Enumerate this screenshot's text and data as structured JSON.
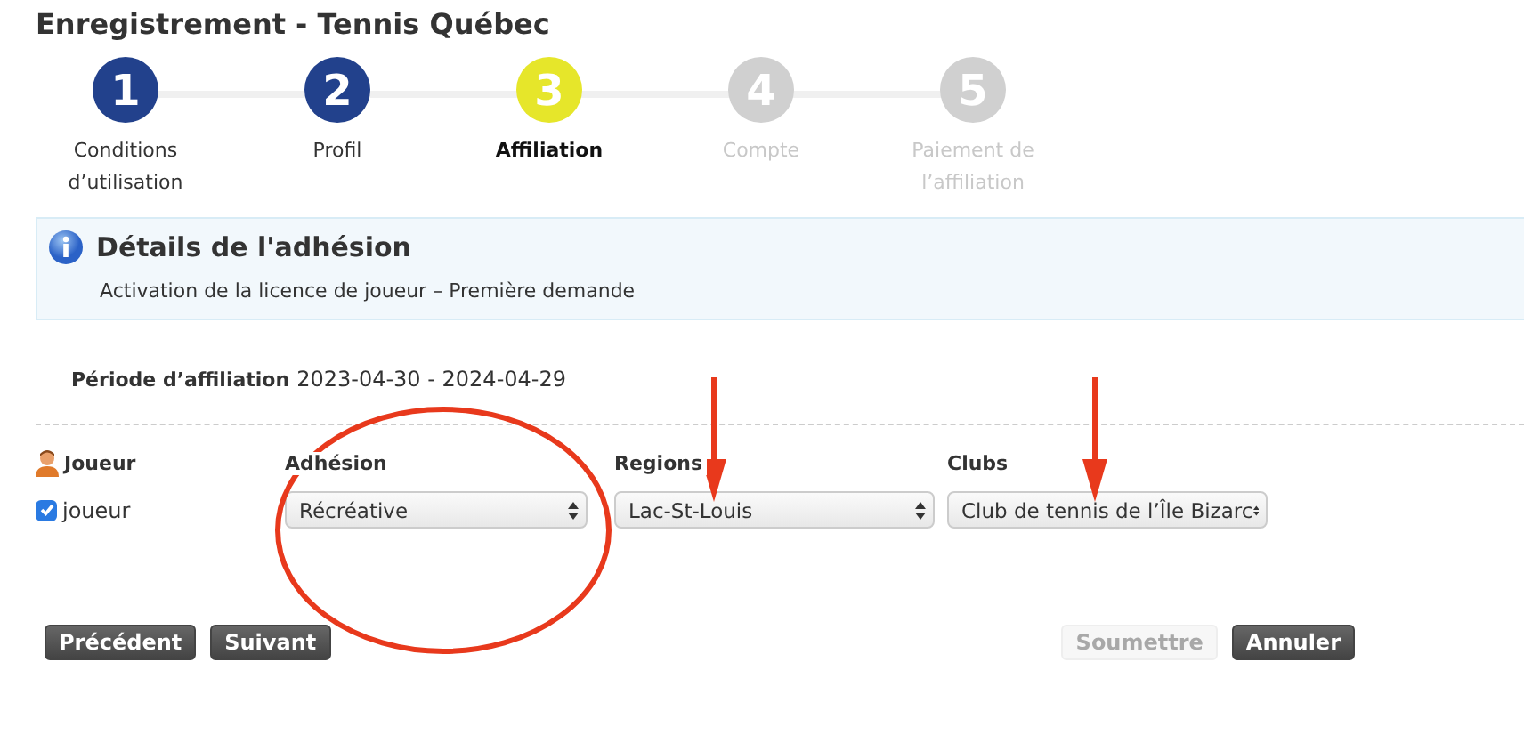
{
  "title": "Enregistrement - Tennis Québec",
  "steps": [
    {
      "number": "1",
      "label": "Conditions d’utilisation",
      "completed": true,
      "selected": false
    },
    {
      "number": "2",
      "label": "Profil",
      "completed": true,
      "selected": false
    },
    {
      "number": "3",
      "label": "Affiliation",
      "completed": false,
      "selected": true
    },
    {
      "number": "4",
      "label": "Compte",
      "completed": false,
      "selected": false
    },
    {
      "number": "5",
      "label": "Paiement de l’affiliation",
      "completed": false,
      "selected": false
    }
  ],
  "info_panel": {
    "heading": "Détails de l'adhésion",
    "text": "Activation de la licence de joueur – Première demande"
  },
  "period": {
    "label": "Période d’affiliation",
    "value": "2023-04-30 - 2024-04-29"
  },
  "table": {
    "columns": [
      "Joueur",
      "Adhésion",
      "Regions",
      "Clubs"
    ],
    "rows": [
      {
        "player": "joueur",
        "checked": true,
        "membership": "Récréative",
        "region": "Lac-St-Louis",
        "club": "Club de tennis de l’Île Bizarc"
      }
    ]
  },
  "buttons_left": [
    {
      "label": "Précédent",
      "disabled": false
    },
    {
      "label": "Suivant",
      "disabled": false
    }
  ],
  "buttons_right": [
    {
      "label": "Soumettre",
      "disabled": true
    },
    {
      "label": "Annuler",
      "disabled": false
    }
  ]
}
